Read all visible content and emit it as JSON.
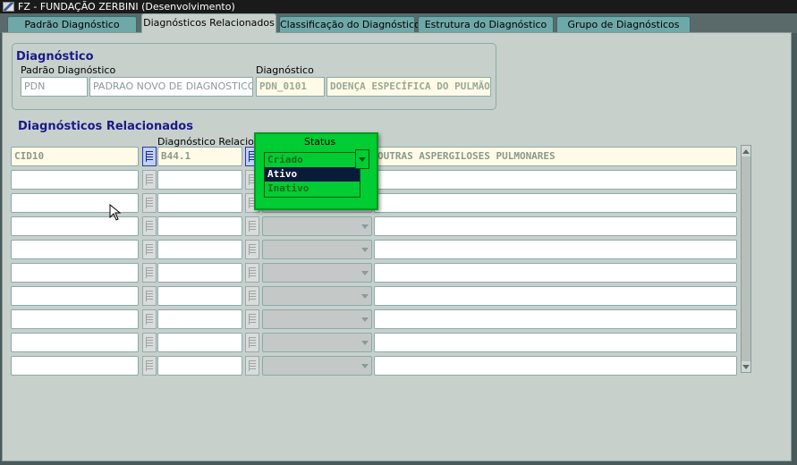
{
  "window": {
    "title": "FZ - FUNDAÇÃO ZERBINI (Desenvolvimento)"
  },
  "tabs": [
    {
      "label": "Padrão Diagnóstico"
    },
    {
      "label": "Diagnósticos Relacionados",
      "active": true
    },
    {
      "label": "Classificação do Diagnóstico"
    },
    {
      "label": "Estrutura do Diagnóstico"
    },
    {
      "label": "Grupo de Diagnósticos"
    }
  ],
  "header": {
    "title": "Diagnóstico",
    "padrao_label": "Padrão Diagnóstico",
    "padrao_code": "PDN",
    "padrao_desc": "PADRAO NOVO DE DIAGNOSTICOS",
    "diag_label": "Diagnóstico",
    "diag_code": "PDN_0101",
    "diag_desc": "DOENÇA ESPECÍFICA DO PULMÃO"
  },
  "related": {
    "title": "Diagnósticos Relacionados",
    "col_related": "Diagnóstico Relacionado",
    "col_status": "Status",
    "first_row": {
      "padrao": "CID10",
      "codigo": "B44.1",
      "descricao": "OUTRAS ASPERGILOSES PULMONARES"
    }
  },
  "status_popup": {
    "options": [
      "Criado",
      "Ativo",
      "Inativo"
    ],
    "selected": "Ativo"
  },
  "colors": {
    "popup_bg": "#00cc33",
    "selected_bg": "#0a1a3a",
    "section_title": "#1a1a8a"
  }
}
